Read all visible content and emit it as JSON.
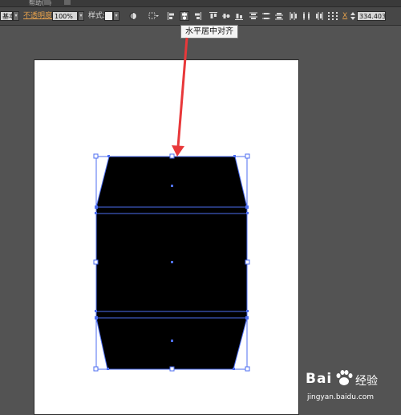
{
  "menubar": {
    "help_label": "帮助(H)"
  },
  "toolbar": {
    "preset_label": "基本",
    "opacity_label": "不透明度",
    "opacity_value": "100%",
    "style_label": "样式:",
    "x_label": "X",
    "x_value": "334.403"
  },
  "tooltip": {
    "text": "水平居中对齐"
  },
  "watermark": {
    "brand": "Bai",
    "brand2": "经验",
    "url": "jingyan.baidu.com"
  },
  "colors": {
    "selection": "#4d6ef0",
    "arrow": "#e8383a",
    "shape": "#000000"
  }
}
